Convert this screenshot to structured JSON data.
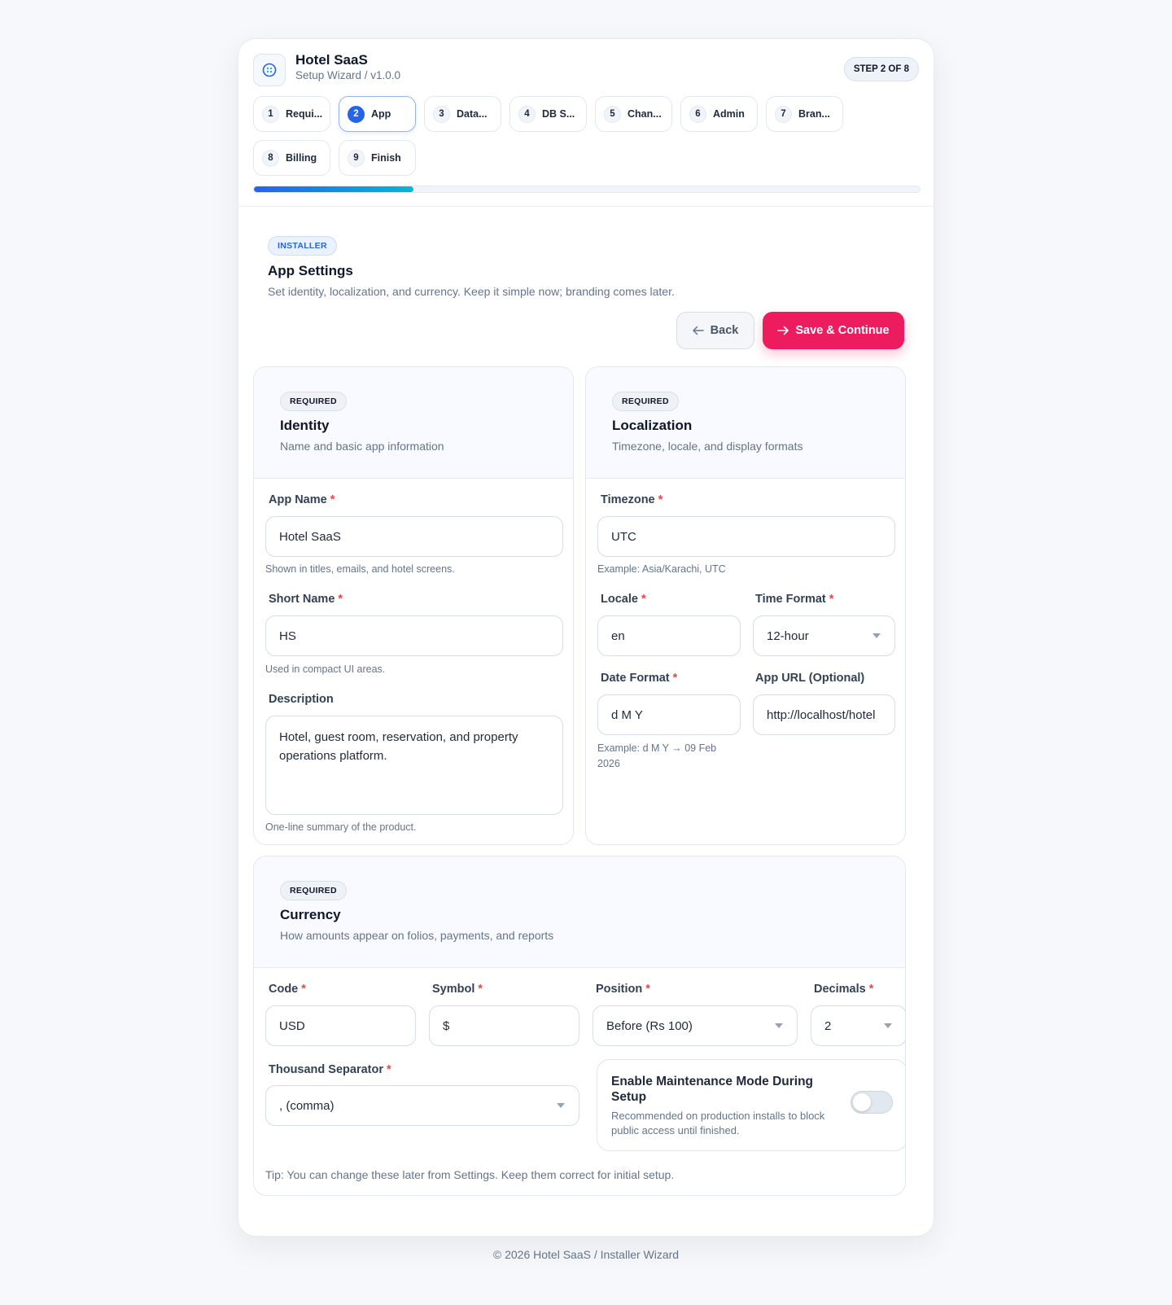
{
  "header": {
    "app_name": "Hotel SaaS",
    "subtitle": "Setup Wizard / v1.0.0",
    "step_badge": "STEP 2 OF 8"
  },
  "steps": [
    {
      "num": "1",
      "label": "Requi..."
    },
    {
      "num": "2",
      "label": "App"
    },
    {
      "num": "3",
      "label": "Data..."
    },
    {
      "num": "4",
      "label": "DB S..."
    },
    {
      "num": "5",
      "label": "Chan..."
    },
    {
      "num": "6",
      "label": "Admin"
    },
    {
      "num": "7",
      "label": "Bran..."
    },
    {
      "num": "8",
      "label": "Billing"
    },
    {
      "num": "9",
      "label": "Finish"
    }
  ],
  "active_step": 2,
  "progress_percent": 24,
  "page": {
    "tag": "INSTALLER",
    "title": "App Settings",
    "description": "Set identity, localization, and currency. Keep it simple now; branding comes later.",
    "back_label": "Back",
    "save_label": "Save & Continue"
  },
  "identity": {
    "tag": "REQUIRED",
    "title": "Identity",
    "subtitle": "Name and basic app information",
    "app_name_label": "App Name",
    "app_name_value": "Hotel SaaS",
    "app_name_hint": "Shown in titles, emails, and hotel screens.",
    "short_name_label": "Short Name",
    "short_name_value": "HS",
    "short_name_hint": "Used in compact UI areas.",
    "description_label": "Description",
    "description_value": "Hotel, guest room, reservation, and property operations platform.",
    "description_hint": "One-line summary of the product."
  },
  "localization": {
    "tag": "REQUIRED",
    "title": "Localization",
    "subtitle": "Timezone, locale, and display formats",
    "timezone_label": "Timezone",
    "timezone_value": "UTC",
    "timezone_hint": "Example: Asia/Karachi, UTC",
    "locale_label": "Locale",
    "locale_value": "en",
    "time_format_label": "Time Format",
    "time_format_value": "12-hour",
    "date_format_label": "Date Format",
    "date_format_value": "d M Y",
    "date_format_hint": "Example: d M Y → 09 Feb 2026",
    "app_url_label": "App URL (Optional)",
    "app_url_value": "http://localhost/hotel"
  },
  "currency": {
    "tag": "REQUIRED",
    "title": "Currency",
    "subtitle": "How amounts appear on folios, payments, and reports",
    "code_label": "Code",
    "code_value": "USD",
    "symbol_label": "Symbol",
    "symbol_value": "$",
    "position_label": "Position",
    "position_value": "Before (Rs 100)",
    "decimals_label": "Decimals",
    "decimals_value": "2",
    "separator_label": "Thousand Separator",
    "separator_value": ", (comma)",
    "maintenance_title": "Enable Maintenance Mode During Setup",
    "maintenance_desc": "Recommended on production installs to block public access until finished.",
    "maintenance_enabled": false,
    "tip": "Tip: You can change these later from Settings. Keep them correct for initial setup."
  },
  "footer": "© 2026 Hotel SaaS / Installer Wizard",
  "colors": {
    "accent": "#2563eb",
    "primary_button": "#ec1c5f",
    "required_star": "#ef4444"
  }
}
